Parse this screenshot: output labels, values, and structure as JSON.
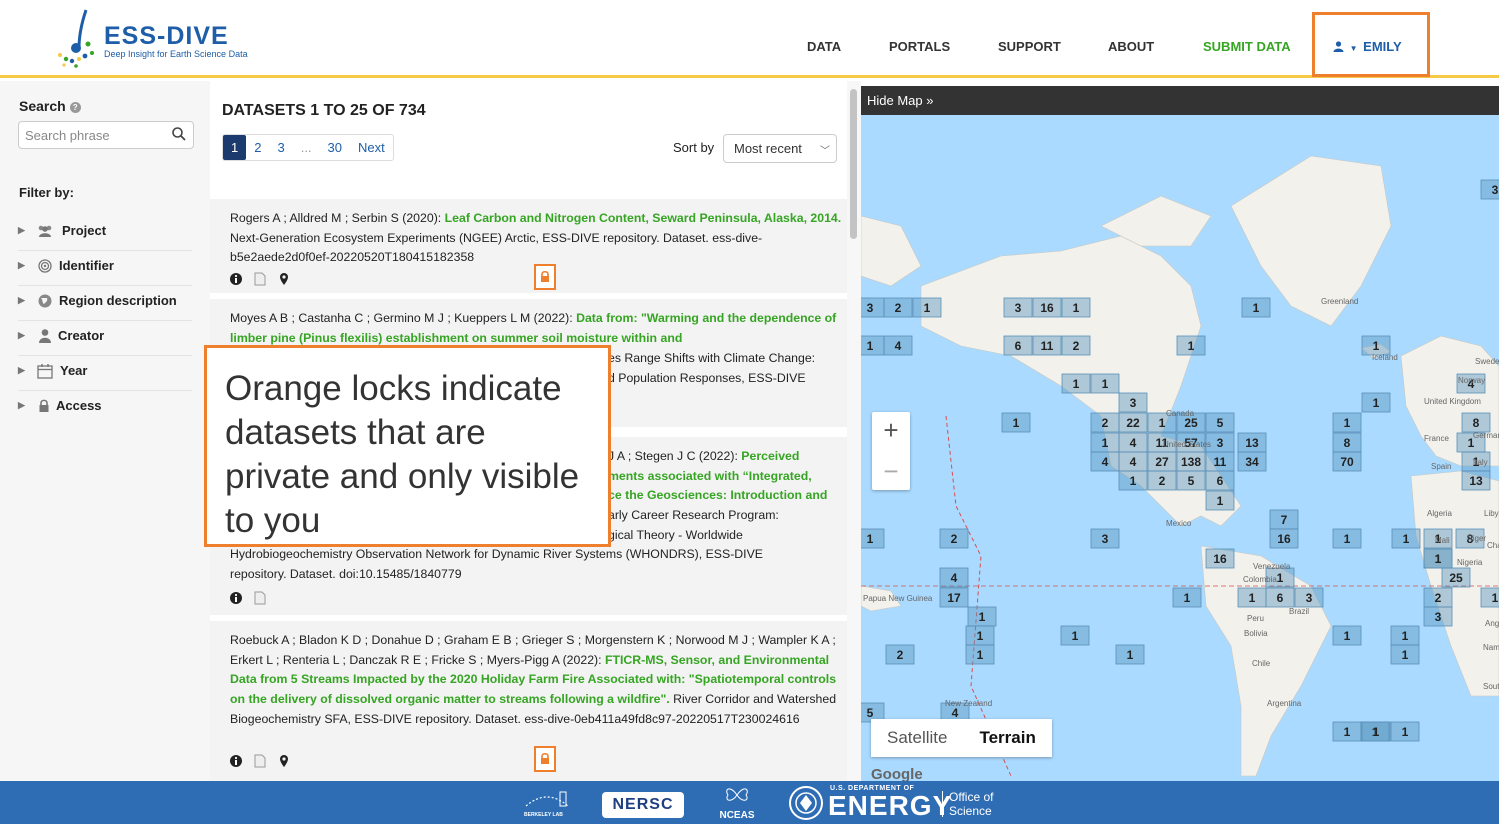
{
  "header": {
    "logo_title": "ESS-DIVE",
    "logo_subtitle": "Deep Insight for Earth Science Data",
    "nav": [
      "DATA",
      "PORTALS",
      "SUPPORT",
      "ABOUT"
    ],
    "submit": "SUBMIT DATA",
    "user": "EMILY"
  },
  "sidebar": {
    "search_label": "Search",
    "search_placeholder": "Search phrase",
    "filter_label": "Filter by:",
    "filters": [
      "Project",
      "Identifier",
      "Region description",
      "Creator",
      "Year",
      "Access"
    ]
  },
  "results": {
    "title": "DATASETS 1 TO 25 OF 734",
    "pages": [
      "1",
      "2",
      "3",
      "...",
      "30",
      "Next"
    ],
    "sort_label": "Sort by",
    "sort_value": "Most recent",
    "items": [
      {
        "authors": "Rogers A ; Alldred M ; Serbin S (2020): ",
        "title": "Leaf Carbon and Nitrogen Content, Seward Peninsula, Alaska, 2014.",
        "rest": " Next-Generation Ecosystem Experiments (NGEE) Arctic, ESS-DIVE repository. Dataset. ess-dive-b5e2aede2d0f0ef-20220520T180415182358"
      },
      {
        "authors": "Moyes A B ; Castanha C ; Germino M J ; Kueppers L M (2022): ",
        "title": "Data from: \"Warming and the dependence of limber pine (Pinus flexilis) establishment on summer soil moisture within and",
        "rest_a": "es Range Shifts with Climate Change:",
        "rest_b": "d Population Responses, ESS-DIVE"
      },
      {
        "line1_a": "J A ; Stegen J C (2022): ",
        "line1_b": "Perceived",
        "line2": "ments associated with “Integrated,",
        "line3": "ce the Geosciences: Introduction and",
        "line4": "arly Career Research Program:",
        "line5": "gical Theory - Worldwide",
        "line6": "Hydrobiogeochemistry Observation Network for Dynamic River Systems (WHONDRS), ESS-DIVE",
        "line7": "repository. Dataset. doi:10.15485/1840779"
      },
      {
        "authors": "Roebuck A ; Bladon K D ; Donahue D ; Graham E B ; Grieger S ; Morgenstern K ; Norwood M J ; Wampler K A ; Erkert L ; Renteria L ; Danczak R E ; Fricke S ; Myers-Pigg A (2022): ",
        "title": "FTICR-MS, Sensor, and Environmental Data from 5 Streams Impacted by the 2020 Holiday Farm Fire Associated with: \"Spatiotemporal controls on the delivery of dissolved organic matter to streams following a wildfire\".",
        "rest": " River Corridor and Watershed Biogeochemistry SFA, ESS-DIVE repository. Dataset. ess-dive-0eb411a49fd8c97-20220517T230024616"
      }
    ]
  },
  "callout": "Orange locks indicate datasets that are private and only visible to you",
  "map": {
    "hide_label": "Hide Map »",
    "satellite": "Satellite",
    "terrain": "Terrain",
    "google": "Google",
    "labels": [
      "Greenland",
      "Canada",
      "United States",
      "Mexico",
      "Venezuela",
      "Colombia",
      "Brazil",
      "Peru",
      "Bolivia",
      "Chile",
      "Argentina",
      "Papua New Guinea",
      "New Zealand",
      "Iceland",
      "Sweden",
      "Norway",
      "United Kingdom",
      "France",
      "Germany",
      "Spain",
      "Italy",
      "Algeria",
      "Libya",
      "Mali",
      "Niger",
      "Nigeria",
      "Chad",
      "Angola",
      "Namibia",
      "South Africa"
    ],
    "cluster_counts": [
      "3",
      "2",
      "1",
      "3",
      "16",
      "1",
      "1",
      "1",
      "4",
      "6",
      "11",
      "2",
      "1",
      "1",
      "4",
      "1",
      "1",
      "3",
      "1",
      "1",
      "2",
      "22",
      "1",
      "25",
      "5",
      "1",
      "8",
      "1",
      "4",
      "11",
      "57",
      "3",
      "13",
      "8",
      "1",
      "4",
      "4",
      "27",
      "138",
      "11",
      "34",
      "70",
      "1",
      "1",
      "2",
      "5",
      "6",
      "13",
      "1",
      "7",
      "16",
      "3",
      "1",
      "1",
      "1",
      "8",
      "1",
      "2",
      "1",
      "16",
      "1",
      "25",
      "4",
      "1",
      "17",
      "6",
      "3",
      "2",
      "1",
      "1",
      "1",
      "3",
      "1",
      "1",
      "1",
      "2",
      "1",
      "1",
      "1",
      "1",
      "1",
      "1",
      "1",
      "4",
      "5",
      "1",
      "1",
      "3"
    ]
  },
  "footer": {
    "berkeley": "BERKELEY LAB",
    "nersc": "NERSC",
    "nceas": "NCEAS",
    "doe_small": "U.S. DEPARTMENT OF",
    "doe_big": "ENERGY",
    "office": "Office of Science"
  }
}
